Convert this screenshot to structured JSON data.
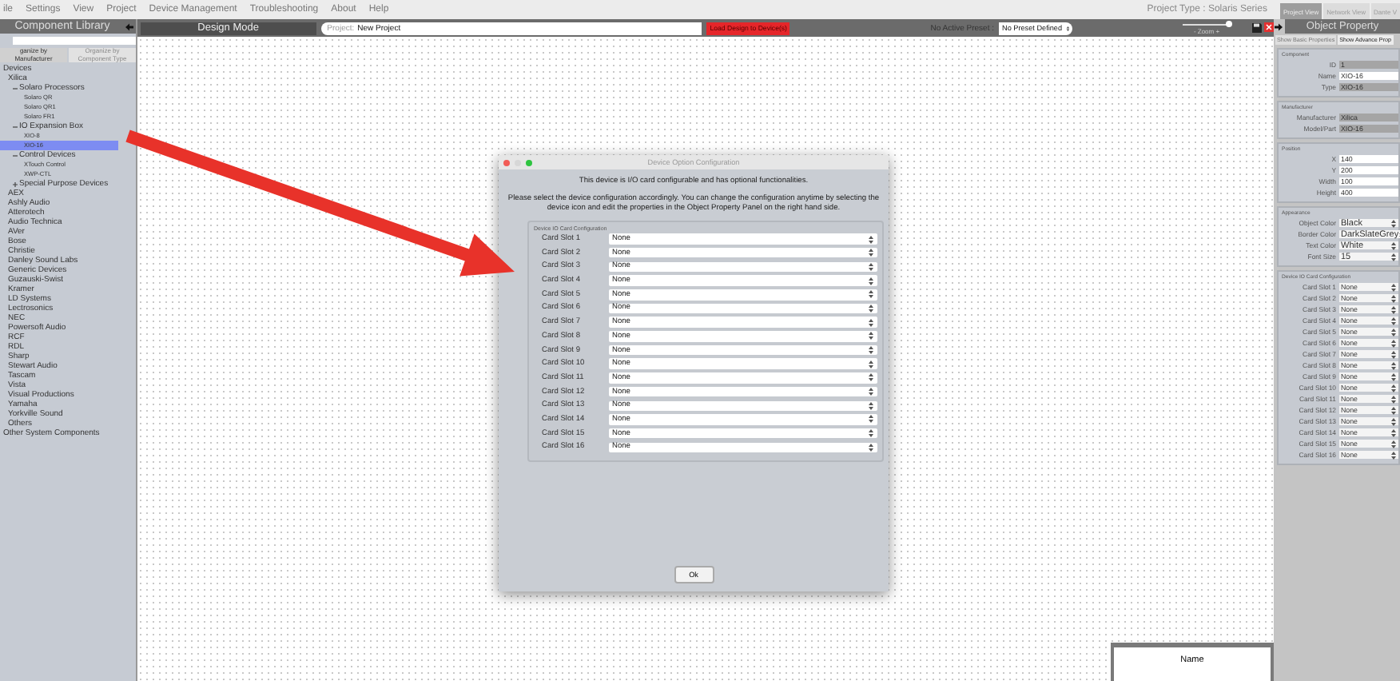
{
  "menu_bar": {
    "items": [
      "ile",
      "Settings",
      "View",
      "Project",
      "Device Management",
      "Troubleshooting",
      "About",
      "Help"
    ],
    "project_type": "Project Type : Solaris Series"
  },
  "view_tabs": [
    {
      "label": "Project View",
      "selected": true
    },
    {
      "label": "Network View",
      "selected": false
    },
    {
      "label": "Dante V",
      "selected": false
    }
  ],
  "component_library": {
    "title": "Component Library",
    "tabs": [
      {
        "label": "ganize by Manufacturer",
        "selected": true
      },
      {
        "label": "Organize by Component Type",
        "selected": false
      }
    ],
    "tree": [
      {
        "label": "Devices",
        "selected": false,
        "children": [
          {
            "label": "Xilica",
            "selected": false,
            "children": [
              {
                "label": "Solaro Processors",
                "expanded": true,
                "selected": false,
                "children": [
                  {
                    "label": "Solaro QR",
                    "selected": false
                  },
                  {
                    "label": "Solaro QR1",
                    "selected": false
                  },
                  {
                    "label": "Solaro FR1",
                    "selected": false
                  }
                ]
              },
              {
                "label": "IO Expansion Box",
                "expanded": true,
                "selected": false,
                "children": [
                  {
                    "label": "XIO-8",
                    "selected": false
                  },
                  {
                    "label": "XIO-16",
                    "selected": true
                  }
                ]
              },
              {
                "label": "Control Devices",
                "expanded": true,
                "selected": false,
                "children": [
                  {
                    "label": "XTouch Control",
                    "selected": false
                  },
                  {
                    "label": "XWP-CTL",
                    "selected": false
                  }
                ]
              },
              {
                "label": "Special Purpose Devices",
                "expanded": false,
                "selected": false
              }
            ]
          },
          {
            "label": "AEX",
            "selected": false
          },
          {
            "label": "Ashly Audio",
            "selected": false
          },
          {
            "label": "Atterotech",
            "selected": false
          },
          {
            "label": "Audio Technica",
            "selected": false
          },
          {
            "label": "AVer",
            "selected": false
          },
          {
            "label": "Bose",
            "selected": false
          },
          {
            "label": "Christie",
            "selected": false
          },
          {
            "label": "Danley Sound Labs",
            "selected": false
          },
          {
            "label": "Generic Devices",
            "selected": false
          },
          {
            "label": "Guzauski-Swist",
            "selected": false
          },
          {
            "label": "Kramer",
            "selected": false
          },
          {
            "label": "LD Systems",
            "selected": false
          },
          {
            "label": "Lectrosonics",
            "selected": false
          },
          {
            "label": "NEC",
            "selected": false
          },
          {
            "label": "Powersoft Audio",
            "selected": false
          },
          {
            "label": "RCF",
            "selected": false
          },
          {
            "label": "RDL",
            "selected": false
          },
          {
            "label": "Sharp",
            "selected": false
          },
          {
            "label": "Stewart Audio",
            "selected": false
          },
          {
            "label": "Tascam",
            "selected": false
          },
          {
            "label": "Vista",
            "selected": false
          },
          {
            "label": "Visual Productions",
            "selected": false
          },
          {
            "label": "Yamaha",
            "selected": false
          },
          {
            "label": "Yorkville Sound",
            "selected": false
          },
          {
            "label": "Others",
            "selected": false
          }
        ]
      },
      {
        "label": "Other System Components",
        "selected": false
      }
    ]
  },
  "toolbar": {
    "mode": "Design Mode",
    "project_label": "Project:",
    "project_name": "New Project",
    "load_button": "Load Design to Device(s)",
    "preset_label": "No Active Preset :",
    "preset": "No Preset Defined",
    "zoom": {
      "label": "- Zoom +",
      "level": 0.95
    }
  },
  "canvas": {
    "name_box": "Name"
  },
  "dialog": {
    "title": "Device Option Configuration",
    "message": "This device is I/O card configurable and has optional functionalities.",
    "instructions": "Please select the device configuration accordingly. You can change the configuration anytime by selecting the device icon and edit the properties in the Object Property Panel on the right hand side.",
    "group_title": "Device IO Card Configuration",
    "slots": [
      {
        "label": "Card Slot 1",
        "value": "None"
      },
      {
        "label": "Card Slot 2",
        "value": "None"
      },
      {
        "label": "Card Slot 3",
        "value": "None"
      },
      {
        "label": "Card Slot 4",
        "value": "None"
      },
      {
        "label": "Card Slot 5",
        "value": "None"
      },
      {
        "label": "Card Slot 6",
        "value": "None"
      },
      {
        "label": "Card Slot 7",
        "value": "None"
      },
      {
        "label": "Card Slot 8",
        "value": "None"
      },
      {
        "label": "Card Slot 9",
        "value": "None"
      },
      {
        "label": "Card Slot 10",
        "value": "None"
      },
      {
        "label": "Card Slot 11",
        "value": "None"
      },
      {
        "label": "Card Slot 12",
        "value": "None"
      },
      {
        "label": "Card Slot 13",
        "value": "None"
      },
      {
        "label": "Card Slot 14",
        "value": "None"
      },
      {
        "label": "Card Slot 15",
        "value": "None"
      },
      {
        "label": "Card Slot 16",
        "value": "None"
      }
    ],
    "ok_button": "Ok"
  },
  "object_property": {
    "title": "Object Property",
    "buttons": [
      "Show Basic Properties",
      "Show Advance Prop"
    ],
    "sections": [
      {
        "title": "Component",
        "fields": [
          {
            "label": "ID",
            "value": "1",
            "kind": "readonly"
          },
          {
            "label": "Name",
            "value": "XIO-16",
            "kind": "input"
          },
          {
            "label": "Type",
            "value": "XIO-16",
            "kind": "readonly"
          }
        ]
      },
      {
        "title": "Manufacturer",
        "fields": [
          {
            "label": "Manufacturer",
            "value": "Xilica",
            "kind": "readonly"
          },
          {
            "label": "Model/Part",
            "value": "XIO-16",
            "kind": "readonly"
          }
        ]
      },
      {
        "title": "Position",
        "fields": [
          {
            "label": "X",
            "value": "140",
            "kind": "input"
          },
          {
            "label": "Y",
            "value": "200",
            "kind": "input"
          },
          {
            "label": "Width",
            "value": "100",
            "kind": "input"
          },
          {
            "label": "Height",
            "value": "400",
            "kind": "input"
          }
        ]
      },
      {
        "title": "Appearance",
        "fields": [
          {
            "label": "Object Color",
            "value": "Black",
            "kind": "select"
          },
          {
            "label": "Border Color",
            "value": "DarkSlateGrey",
            "kind": "select"
          },
          {
            "label": "Text Color",
            "value": "White",
            "kind": "select"
          },
          {
            "label": "Font Size",
            "value": "15",
            "kind": "select"
          }
        ]
      },
      {
        "title": "Device IO Card Configuration",
        "fields": [
          {
            "label": "Card Slot 1",
            "value": "None",
            "kind": "select"
          },
          {
            "label": "Card Slot 2",
            "value": "None",
            "kind": "select"
          },
          {
            "label": "Card Slot 3",
            "value": "None",
            "kind": "select"
          },
          {
            "label": "Card Slot 4",
            "value": "None",
            "kind": "select"
          },
          {
            "label": "Card Slot 5",
            "value": "None",
            "kind": "select"
          },
          {
            "label": "Card Slot 6",
            "value": "None",
            "kind": "select"
          },
          {
            "label": "Card Slot 7",
            "value": "None",
            "kind": "select"
          },
          {
            "label": "Card Slot 8",
            "value": "None",
            "kind": "select"
          },
          {
            "label": "Card Slot 9",
            "value": "None",
            "kind": "select"
          },
          {
            "label": "Card Slot 10",
            "value": "None",
            "kind": "select"
          },
          {
            "label": "Card Slot 11",
            "value": "None",
            "kind": "select"
          },
          {
            "label": "Card Slot 12",
            "value": "None",
            "kind": "select"
          },
          {
            "label": "Card Slot 13",
            "value": "None",
            "kind": "select"
          },
          {
            "label": "Card Slot 14",
            "value": "None",
            "kind": "select"
          },
          {
            "label": "Card Slot 15",
            "value": "None",
            "kind": "select"
          },
          {
            "label": "Card Slot 16",
            "value": "None",
            "kind": "select"
          }
        ]
      }
    ]
  }
}
